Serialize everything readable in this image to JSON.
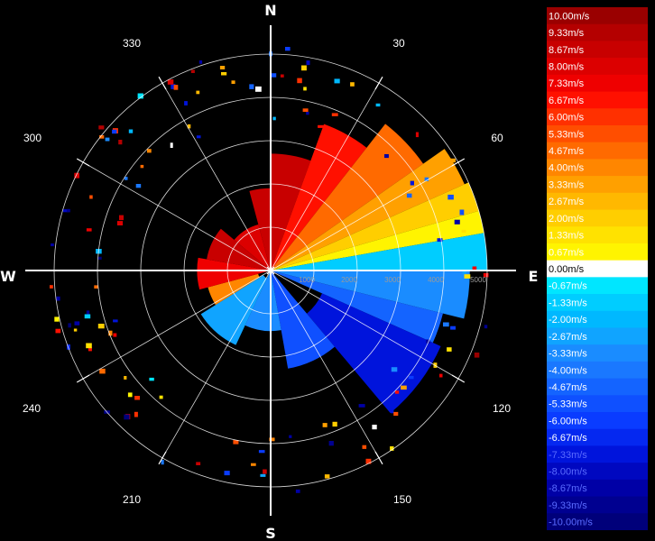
{
  "chart_data": {
    "type": "heatmap",
    "subtype": "polar-ppi",
    "quantity": "radial velocity",
    "unit": "m/s",
    "compass_labels": [
      "N",
      "E",
      "S",
      "W"
    ],
    "bearing_labels": [
      "30",
      "60",
      "120",
      "150",
      "210",
      "240",
      "300",
      "330"
    ],
    "range_labels": [
      "1000",
      "2000",
      "3000",
      "4000",
      "5000"
    ],
    "range_max": 5000,
    "range_rings": [
      1000,
      2000,
      3000,
      4000,
      5000
    ],
    "spokes_deg": [
      0,
      30,
      60,
      90,
      120,
      150,
      180,
      210,
      240,
      270,
      300,
      330
    ],
    "colorbar_labels": [
      "10.00m/s",
      "9.33m/s",
      "8.67m/s",
      "8.00m/s",
      "7.33m/s",
      "6.67m/s",
      "6.00m/s",
      "5.33m/s",
      "4.67m/s",
      "4.00m/s",
      "3.33m/s",
      "2.67m/s",
      "2.00m/s",
      "1.33m/s",
      "0.67m/s",
      "0.00m/s",
      "-0.67m/s",
      "-1.33m/s",
      "-2.00m/s",
      "-2.67m/s",
      "-3.33m/s",
      "-4.00m/s",
      "-4.67m/s",
      "-5.33m/s",
      "-6.00m/s",
      "-6.67m/s",
      "-7.33m/s",
      "-8.00m/s",
      "-8.67m/s",
      "-9.33m/s",
      "-10.00m/s"
    ],
    "colorbar_colors": [
      "#9a0000",
      "#b40000",
      "#c80000",
      "#dc0000",
      "#ef0000",
      "#ff1000",
      "#ff3000",
      "#ff4e00",
      "#ff6a00",
      "#ff8600",
      "#ffa000",
      "#ffb800",
      "#ffce00",
      "#ffe200",
      "#fff400",
      "#ffffff",
      "#00e6ff",
      "#00cdff",
      "#00b8ff",
      "#10a4ff",
      "#1a8cff",
      "#1a78ff",
      "#1464ff",
      "#0f50ff",
      "#0a3cff",
      "#0528f0",
      "#0014dc",
      "#0008c0",
      "#0000a6",
      "#000090",
      "#00007a"
    ],
    "sectors": [
      {
        "az_start": 0,
        "az_end": 20,
        "r_start": 0,
        "r_end": 2700,
        "value": 8.6
      },
      {
        "az_start": 20,
        "az_end": 38,
        "r_start": 0,
        "r_end": 3600,
        "value": 7.0
      },
      {
        "az_start": 38,
        "az_end": 55,
        "r_start": 0,
        "r_end": 4300,
        "value": 4.8
      },
      {
        "az_start": 55,
        "az_end": 66,
        "r_start": 0,
        "r_end": 4900,
        "value": 3.5
      },
      {
        "az_start": 66,
        "az_end": 74,
        "r_start": 0,
        "r_end": 5000,
        "value": 2.0
      },
      {
        "az_start": 74,
        "az_end": 80,
        "r_start": 0,
        "r_end": 5000,
        "value": 0.7
      },
      {
        "az_start": 80,
        "az_end": 90,
        "r_start": 0,
        "r_end": 5000,
        "value": -1.4
      },
      {
        "az_start": 90,
        "az_end": 104,
        "r_start": 0,
        "r_end": 4600,
        "value": -3.6
      },
      {
        "az_start": 104,
        "az_end": 114,
        "r_start": 0,
        "r_end": 4100,
        "value": -4.8
      },
      {
        "az_start": 114,
        "az_end": 140,
        "r_start": 1300,
        "r_end": 4300,
        "value": -7.2
      },
      {
        "az_start": 140,
        "az_end": 170,
        "r_start": 0,
        "r_end": 2300,
        "value": -5.4
      },
      {
        "az_start": 170,
        "az_end": 205,
        "r_start": 0,
        "r_end": 1400,
        "value": -3.2
      },
      {
        "az_start": 205,
        "az_end": 238,
        "r_start": 200,
        "r_end": 1900,
        "value": -2.6
      },
      {
        "az_start": 238,
        "az_end": 255,
        "r_start": 300,
        "r_end": 1500,
        "value": 4.2
      },
      {
        "az_start": 255,
        "az_end": 280,
        "r_start": 0,
        "r_end": 1700,
        "value": 7.4
      },
      {
        "az_start": 280,
        "az_end": 310,
        "r_start": 0,
        "r_end": 1500,
        "value": 8.8
      },
      {
        "az_start": 310,
        "az_end": 345,
        "r_start": 0,
        "r_end": 1100,
        "value": 8.2
      },
      {
        "az_start": 345,
        "az_end": 360,
        "r_start": 0,
        "r_end": 1900,
        "value": 9.0
      }
    ]
  }
}
